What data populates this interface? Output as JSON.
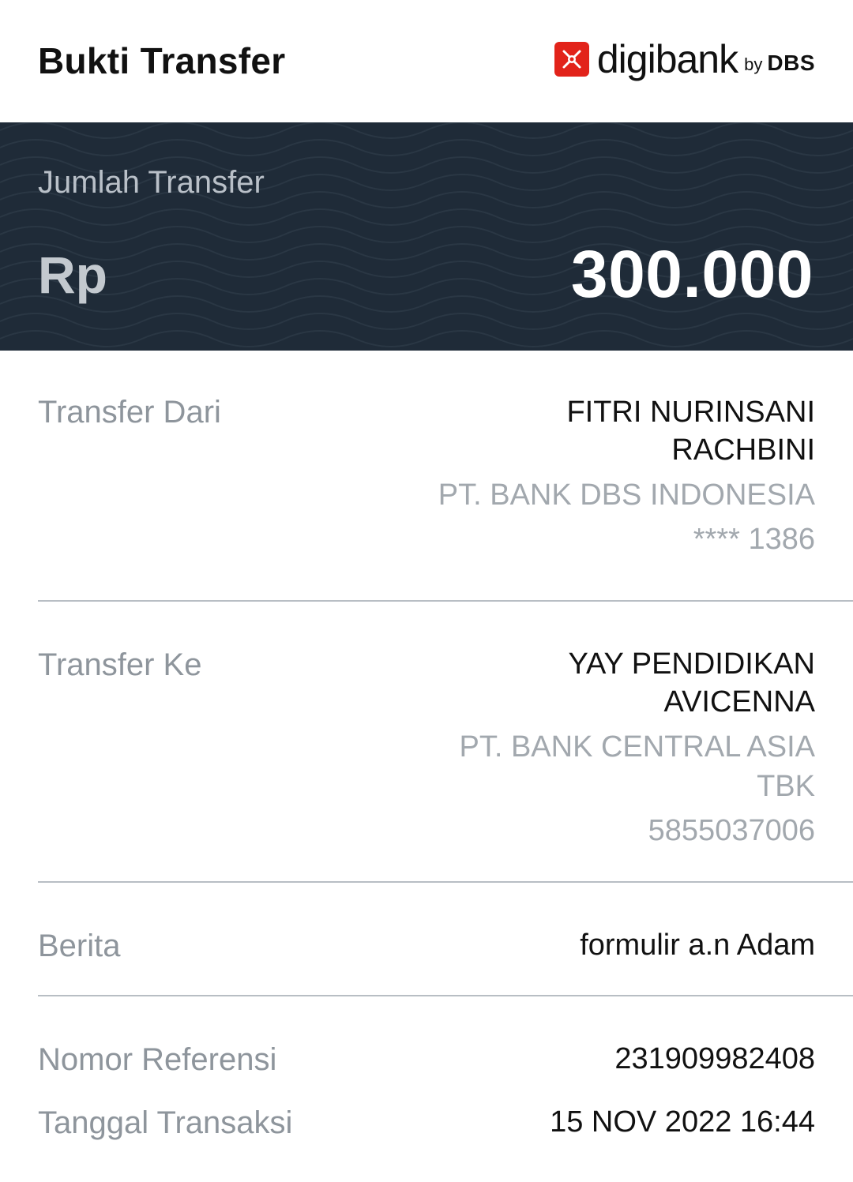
{
  "header": {
    "title": "Bukti Transfer",
    "logo_text": "digibank",
    "logo_by": "by",
    "logo_brand": "DBS",
    "logo_color": "#e2231a"
  },
  "amount": {
    "label": "Jumlah Transfer",
    "currency": "Rp",
    "value": "300.000"
  },
  "transfer_from": {
    "label": "Transfer Dari",
    "name_line1": "FITRI NURINSANI",
    "name_line2": "RACHBINI",
    "bank": "PT. BANK DBS INDONESIA",
    "account": "**** 1386"
  },
  "transfer_to": {
    "label": "Transfer Ke",
    "name_line1": "YAY PENDIDIKAN",
    "name_line2": "AVICENNA",
    "bank_line1": "PT. BANK CENTRAL ASIA",
    "bank_line2": "TBK",
    "account": "5855037006"
  },
  "message": {
    "label": "Berita",
    "value": "formulir a.n Adam"
  },
  "reference": {
    "label": "Nomor Referensi",
    "value": "231909982408"
  },
  "transaction_date": {
    "label": "Tanggal Transaksi",
    "value": "15 NOV 2022 16:44"
  },
  "colors": {
    "band_background": "#1f2b38",
    "label_gray": "#8e959c",
    "secondary_gray": "#a2a8ae"
  }
}
